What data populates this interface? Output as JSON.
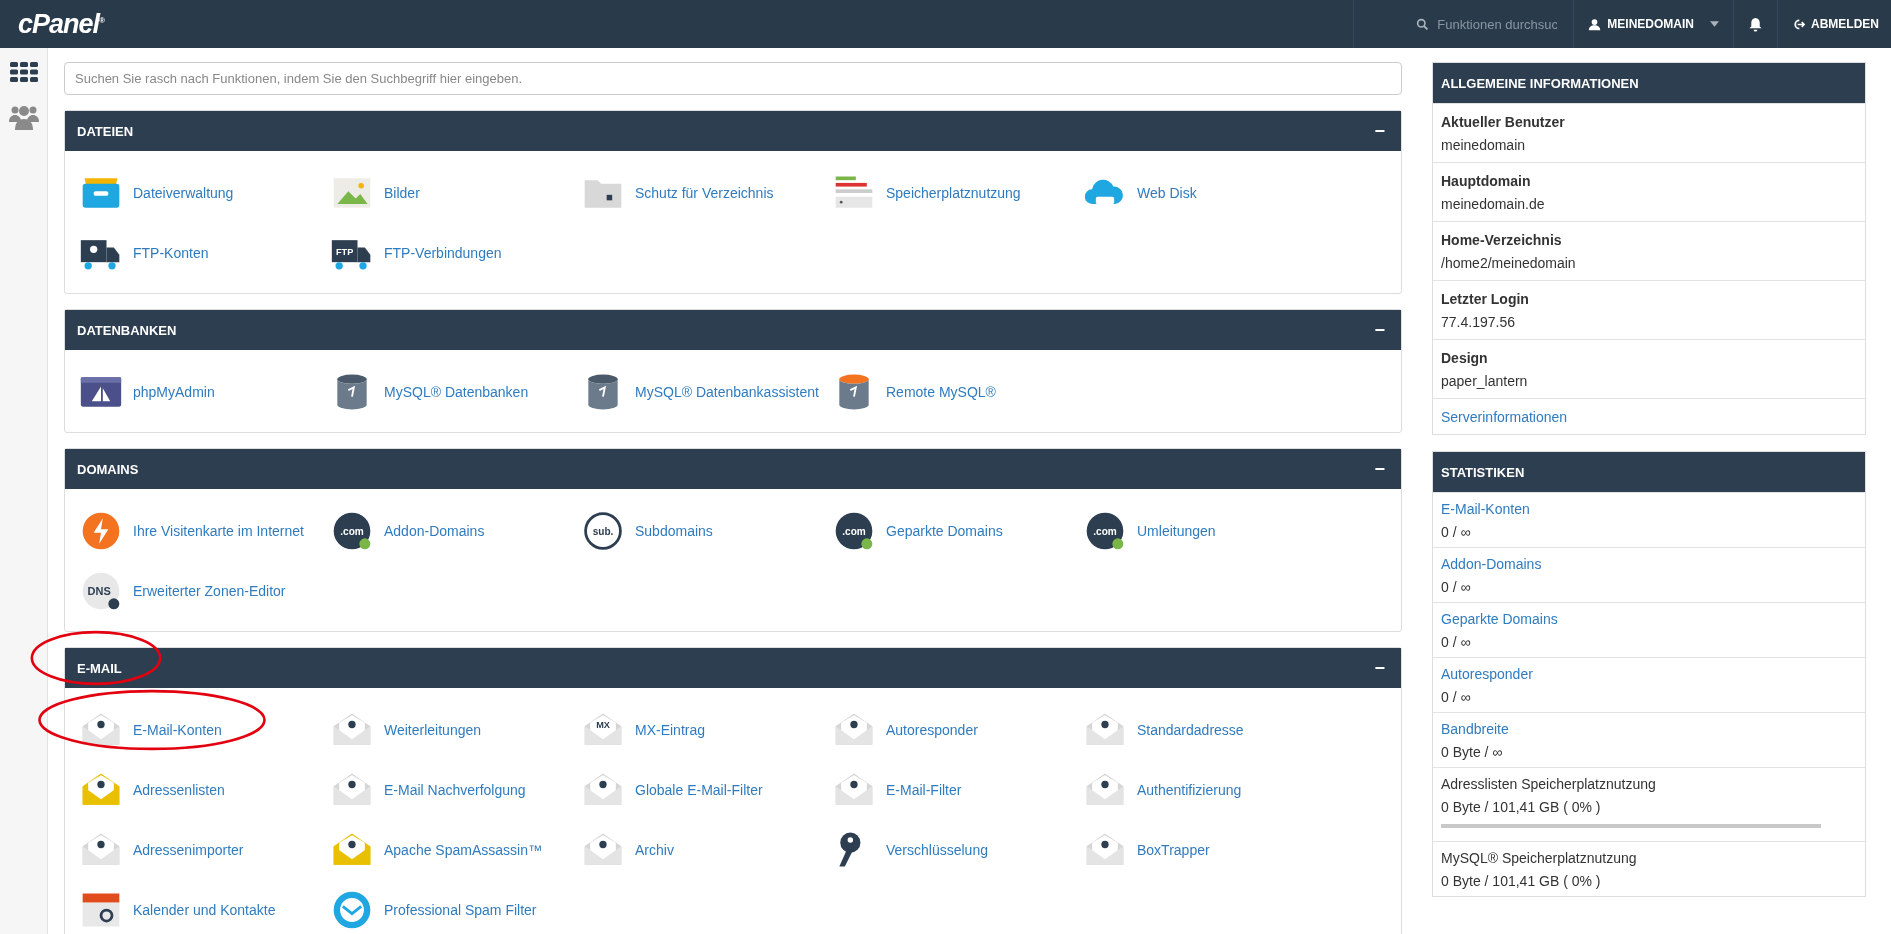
{
  "topbar": {
    "logo": "cPanel$^{®}$",
    "search": {
      "placeholder": "Funktionen durchsuc"
    },
    "user": "MEINEDOMAIN",
    "logout": "ABMELDEN"
  },
  "search": {
    "placeholder": "Suchen Sie rasch nach Funktionen, indem Sie den Suchbegriff hier eingeben."
  },
  "sections": [
    {
      "title": "DATEIEN",
      "toggle": "−",
      "items": [
        {
          "label": "Dateiverwaltung"
        },
        {
          "label": "Bilder"
        },
        {
          "label": "Schutz für Verzeichnis"
        },
        {
          "label": "Speicherplatznutzung"
        },
        {
          "label": "Web Disk"
        },
        {
          "label": "FTP-Konten"
        },
        {
          "label": "FTP-Verbindungen",
          "icon_text": "FTP"
        }
      ]
    },
    {
      "title": "DATENBANKEN",
      "toggle": "−",
      "items": [
        {
          "label": "phpMyAdmin"
        },
        {
          "label": "MySQL® Datenbanken"
        },
        {
          "label": "MySQL® Datenbankassistent"
        },
        {
          "label": "Remote MySQL®"
        }
      ]
    },
    {
      "title": "DOMAINS",
      "toggle": "−",
      "items": [
        {
          "label": "Ihre Visitenkarte im Internet"
        },
        {
          "label": "Addon-Domains",
          "icon_text": ".com"
        },
        {
          "label": "Subdomains",
          "icon_text": "sub."
        },
        {
          "label": "Geparkte Domains",
          "icon_text": ".com"
        },
        {
          "label": "Umleitungen",
          "icon_text": ".com"
        },
        {
          "label": "Erweiterter Zonen-Editor",
          "icon_text": "DNS"
        }
      ]
    },
    {
      "title": "E-MAIL",
      "toggle": "−",
      "items": [
        {
          "label": "E-Mail-Konten"
        },
        {
          "label": "Weiterleitungen"
        },
        {
          "label": "MX-Eintrag",
          "icon_text": "MX"
        },
        {
          "label": "Autoresponder"
        },
        {
          "label": "Standardadresse"
        },
        {
          "label": "Adressenlisten"
        },
        {
          "label": "E-Mail Nachverfolgung"
        },
        {
          "label": "Globale E-Mail-Filter"
        },
        {
          "label": "E-Mail-Filter"
        },
        {
          "label": "Authentifizierung"
        },
        {
          "label": "Adressenimporter"
        },
        {
          "label": "Apache SpamAssassin™"
        },
        {
          "label": "Archiv"
        },
        {
          "label": "Verschlüsselung"
        },
        {
          "label": "BoxTrapper"
        },
        {
          "label": "Kalender und Kontakte"
        },
        {
          "label": "Professional Spam Filter"
        }
      ]
    }
  ],
  "info": {
    "title": "ALLGEMEINE INFORMATIONEN",
    "rows": [
      {
        "kind": "field",
        "label": "Aktueller Benutzer",
        "value": "meinedomain"
      },
      {
        "kind": "field",
        "label": "Hauptdomain",
        "value": "meinedomain.de"
      },
      {
        "kind": "field",
        "label": "Home-Verzeichnis",
        "value": "/home2/meinedomain"
      },
      {
        "kind": "field",
        "label": "Letzter Login",
        "value": "77.4.197.56"
      },
      {
        "kind": "field",
        "label": "Design",
        "value": "paper_lantern"
      },
      {
        "kind": "link",
        "label": "Serverinformationen"
      }
    ]
  },
  "stats": {
    "title": "STATISTIKEN",
    "rows": [
      {
        "kind": "link",
        "label": "E-Mail-Konten",
        "value": "0 / ∞"
      },
      {
        "kind": "link",
        "label": "Addon-Domains",
        "value": "0 / ∞"
      },
      {
        "kind": "link",
        "label": "Geparkte Domains",
        "value": "0 / ∞"
      },
      {
        "kind": "link",
        "label": "Autoresponder",
        "value": "0 / ∞"
      },
      {
        "kind": "link",
        "label": "Bandbreite",
        "value": "0 Byte / ∞"
      },
      {
        "kind": "plain",
        "label": "Adresslisten Speicherplatznutzung",
        "value": "0 Byte / 101,41 GB ( 0% )",
        "level": 0
      },
      {
        "kind": "plain",
        "label": "MySQL® Speicherplatznutzung",
        "value": "0 Byte / 101,41 GB ( 0% )"
      }
    ]
  }
}
